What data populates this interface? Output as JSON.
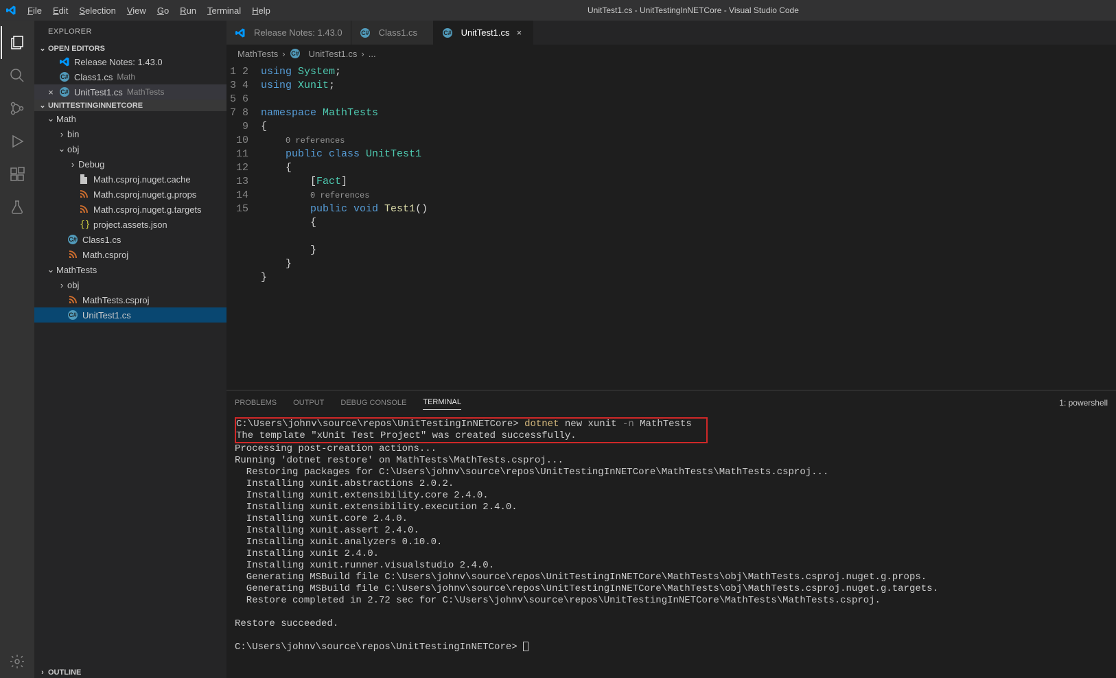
{
  "title": "UnitTest1.cs - UnitTestingInNETCore - Visual Studio Code",
  "menu": [
    "File",
    "Edit",
    "Selection",
    "View",
    "Go",
    "Run",
    "Terminal",
    "Help"
  ],
  "sidebar": {
    "title": "EXPLORER",
    "openEditorsHeader": "OPEN EDITORS",
    "openEditors": [
      {
        "label": "Release Notes: 1.43.0",
        "dim": "",
        "icon": "vscode"
      },
      {
        "label": "Class1.cs",
        "dim": "Math",
        "icon": "cs"
      },
      {
        "label": "UnitTest1.cs",
        "dim": "MathTests",
        "icon": "cs",
        "active": true
      }
    ],
    "workspaceHeader": "UNITTESTINGINNETCORE",
    "tree": [
      {
        "label": "Math",
        "type": "folder",
        "open": true,
        "depth": 1
      },
      {
        "label": "bin",
        "type": "folder",
        "open": false,
        "depth": 2
      },
      {
        "label": "obj",
        "type": "folder",
        "open": true,
        "depth": 2
      },
      {
        "label": "Debug",
        "type": "folder",
        "open": false,
        "depth": 3
      },
      {
        "label": "Math.csproj.nuget.cache",
        "type": "file",
        "icon": "file",
        "depth": 3
      },
      {
        "label": "Math.csproj.nuget.g.props",
        "type": "file",
        "icon": "rss",
        "depth": 3
      },
      {
        "label": "Math.csproj.nuget.g.targets",
        "type": "file",
        "icon": "rss",
        "depth": 3
      },
      {
        "label": "project.assets.json",
        "type": "file",
        "icon": "json",
        "depth": 3
      },
      {
        "label": "Class1.cs",
        "type": "file",
        "icon": "cs",
        "depth": 2
      },
      {
        "label": "Math.csproj",
        "type": "file",
        "icon": "rss",
        "depth": 2
      },
      {
        "label": "MathTests",
        "type": "folder",
        "open": true,
        "depth": 1
      },
      {
        "label": "obj",
        "type": "folder",
        "open": false,
        "depth": 2
      },
      {
        "label": "MathTests.csproj",
        "type": "file",
        "icon": "rss",
        "depth": 2
      },
      {
        "label": "UnitTest1.cs",
        "type": "file",
        "icon": "cs",
        "depth": 2,
        "selected": true
      }
    ],
    "outline": "OUTLINE"
  },
  "tabs": [
    {
      "label": "Release Notes: 1.43.0",
      "icon": "vscode"
    },
    {
      "label": "Class1.cs",
      "icon": "cs"
    },
    {
      "label": "UnitTest1.cs",
      "icon": "cs",
      "active": true
    }
  ],
  "breadcrumb": {
    "a": "MathTests",
    "b": "UnitTest1.cs",
    "c": "..."
  },
  "code": {
    "lines": [
      "1",
      "2",
      "3",
      "4",
      "5",
      "6",
      "7",
      "8",
      "9",
      "10",
      "11",
      "12",
      "13",
      "14",
      "15"
    ],
    "l1a": "using ",
    "l1b": "System",
    "l1c": ";",
    "l2a": "using ",
    "l2b": "Xunit",
    "l2c": ";",
    "l4a": "namespace ",
    "l4b": "MathTests",
    "l5": "{",
    "ref": "0 references",
    "l6a": "public ",
    "l6b": "class ",
    "l6c": "UnitTest1",
    "l7": "{",
    "l8a": "[",
    "l8b": "Fact",
    "l8c": "]",
    "l9a": "public ",
    "l9b": "void ",
    "l9c": "Test1",
    "l9d": "()",
    "l10": "{",
    "l12": "}",
    "l13": "}",
    "l14": "}"
  },
  "panel": {
    "tabs": [
      "PROBLEMS",
      "OUTPUT",
      "DEBUG CONSOLE",
      "TERMINAL"
    ],
    "right": "1: powershell",
    "prompt": "C:\\Users\\johnv\\source\\repos\\UnitTestingInNETCore> ",
    "cmd1": "dotnet",
    "cmd2": " new xunit ",
    "cmd3": "-n",
    "cmd4": " MathTests",
    "line2": "The template \"xUnit Test Project\" was created successfully.",
    "body": "\nProcessing post-creation actions...\nRunning 'dotnet restore' on MathTests\\MathTests.csproj...\n  Restoring packages for C:\\Users\\johnv\\source\\repos\\UnitTestingInNETCore\\MathTests\\MathTests.csproj...\n  Installing xunit.abstractions 2.0.2.\n  Installing xunit.extensibility.core 2.4.0.\n  Installing xunit.extensibility.execution 2.4.0.\n  Installing xunit.core 2.4.0.\n  Installing xunit.assert 2.4.0.\n  Installing xunit.analyzers 0.10.0.\n  Installing xunit 2.4.0.\n  Installing xunit.runner.visualstudio 2.4.0.\n  Generating MSBuild file C:\\Users\\johnv\\source\\repos\\UnitTestingInNETCore\\MathTests\\obj\\MathTests.csproj.nuget.g.props.\n  Generating MSBuild file C:\\Users\\johnv\\source\\repos\\UnitTestingInNETCore\\MathTests\\obj\\MathTests.csproj.nuget.g.targets.\n  Restore completed in 2.72 sec for C:\\Users\\johnv\\source\\repos\\UnitTestingInNETCore\\MathTests\\MathTests.csproj.\n\nRestore succeeded.\n"
  }
}
